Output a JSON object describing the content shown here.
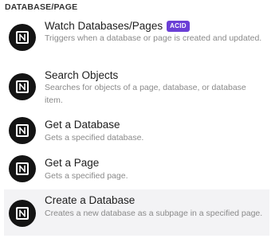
{
  "section": {
    "header": "DATABASE/PAGE"
  },
  "items": [
    {
      "title": "Watch Databases/Pages",
      "badge": "ACID",
      "description": "Triggers when a database or page is created and updated.",
      "icon": "notion-icon"
    },
    {
      "title": "Search Objects",
      "description": "Searches for objects of a page, database, or database item.",
      "icon": "notion-icon"
    },
    {
      "title": "Get a Database",
      "description": "Gets a specified database.",
      "icon": "notion-icon"
    },
    {
      "title": "Get a Page",
      "description": "Gets a specified page.",
      "icon": "notion-icon"
    },
    {
      "title": "Create a Database",
      "description": "Creates a new database as a subpage in a specified page.",
      "icon": "notion-icon",
      "hovered": true
    }
  ],
  "colors": {
    "badge": "#6b3fd6",
    "icon_bg": "#141414",
    "hover_bg": "#f3f3f5",
    "description": "#8a8a8a"
  }
}
